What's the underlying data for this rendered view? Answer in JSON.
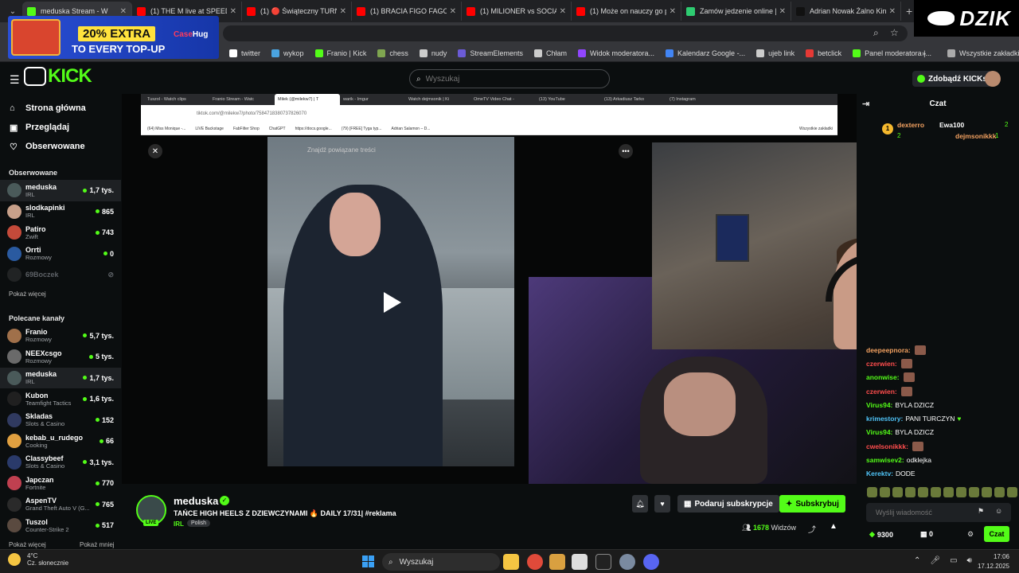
{
  "browser": {
    "tabs": [
      {
        "label": "meduska Stream - W",
        "color": "#53fc18",
        "active": true
      },
      {
        "label": "(1) THE M live at SPEEDL",
        "color": "#ff0000"
      },
      {
        "label": "(1) 🔴 Świąteczny TURNI",
        "color": "#ff0000"
      },
      {
        "label": "(1) BRACIA FIGO FAGOT",
        "color": "#ff0000"
      },
      {
        "label": "(1) MILIONER vs SOCIALI",
        "color": "#ff0000"
      },
      {
        "label": "(1) Może on nauczy go pr",
        "color": "#ff0000"
      },
      {
        "label": "Zamów jedzenie online |",
        "color": "#2ecc71"
      },
      {
        "label": "Adrian Nowak Żalno Kin",
        "color": "#111111"
      }
    ],
    "bookmarks": [
      {
        "label": "twitter",
        "color": "#ffffff"
      },
      {
        "label": "wykop",
        "color": "#4aa3df"
      },
      {
        "label": "Franio | Kick",
        "color": "#53fc18"
      },
      {
        "label": "chess",
        "color": "#7fa650"
      },
      {
        "label": "nudy",
        "color": "#cccccc"
      },
      {
        "label": "StreamElements",
        "color": "#6b5bd6"
      },
      {
        "label": "Chłam",
        "color": "#cccccc"
      },
      {
        "label": "Widok moderatora...",
        "color": "#9146ff"
      },
      {
        "label": "Kalendarz Google -...",
        "color": "#4285f4"
      },
      {
        "label": "ujeb link",
        "color": "#cccccc"
      },
      {
        "label": "betclick",
        "color": "#e53935"
      },
      {
        "label": "Panel moderatora |...",
        "color": "#53fc18"
      }
    ],
    "all_bookmarks": "Wszystkie zakładki"
  },
  "promo": {
    "pill": "20% EXTRA",
    "sub": "TO EVERY TOP-UP",
    "brand_a": "Case",
    "brand_b": "Hug"
  },
  "overlay_brand": "DZIK",
  "header": {
    "logo": "KICK",
    "search_placeholder": "Wyszukaj",
    "kicks_label": "Zdobądź KICKs"
  },
  "sidebar": {
    "nav": [
      {
        "label": "Strona główna",
        "icon": "home-icon",
        "glyph": "⌂"
      },
      {
        "label": "Przeglądaj",
        "icon": "browse-icon",
        "glyph": "▣"
      },
      {
        "label": "Obserwowane",
        "icon": "heart-icon",
        "glyph": "♡"
      }
    ],
    "followed_title": "Obserwowane",
    "followed": [
      {
        "name": "meduska",
        "category": "IRL",
        "viewers": "1,7 tys.",
        "color": "#4a5a5a",
        "selected": true
      },
      {
        "name": "slodkapinki",
        "category": "IRL",
        "viewers": "865",
        "color": "#c7a08a"
      },
      {
        "name": "Patiro",
        "category": "Zwift",
        "viewers": "743",
        "color": "#c44a3a"
      },
      {
        "name": "Orrti",
        "category": "Rozmowy",
        "viewers": "0",
        "color": "#2a5aa0"
      },
      {
        "name": "69Boczek",
        "category": "",
        "viewers": "",
        "color": "#444444",
        "offline": true
      }
    ],
    "show_more": "Pokaż więcej",
    "recommended_title": "Polecane kanały",
    "recommended": [
      {
        "name": "Franio",
        "category": "Rozmowy",
        "viewers": "5,7 tys.",
        "color": "#a0704a"
      },
      {
        "name": "NEEXcsgo",
        "category": "Rozmowy",
        "viewers": "5 tys.",
        "color": "#6a6a6a"
      },
      {
        "name": "meduska",
        "category": "IRL",
        "viewers": "1,7 tys.",
        "color": "#4a5a5a",
        "selected": true
      },
      {
        "name": "Kubon",
        "category": "Teamfight Tactics",
        "viewers": "1,6 tys.",
        "color": "#202020"
      },
      {
        "name": "Skladas",
        "category": "Slots & Casino",
        "viewers": "152",
        "color": "#303a60"
      },
      {
        "name": "kebab_u_rudego",
        "category": "Cooking",
        "viewers": "66",
        "color": "#e0a040"
      },
      {
        "name": "Classybeef",
        "category": "Slots & Casino",
        "viewers": "3,1 tys.",
        "color": "#2a3a6a"
      },
      {
        "name": "Japczan",
        "category": "Fortnite",
        "viewers": "770",
        "color": "#c04050"
      },
      {
        "name": "AspenTV",
        "category": "Grand Theft Auto V (G...",
        "viewers": "765",
        "color": "#2a2a2a"
      },
      {
        "name": "Tuszol",
        "category": "Counter-Strike 2",
        "viewers": "517",
        "color": "#5a4a40"
      }
    ],
    "show_more2": "Pokaż więcej",
    "show_less": "Pokaż mniej"
  },
  "inner_browser": {
    "tabs": [
      "Tuszol - Watch clips",
      "Franio Stream - Watc",
      "Milek (@milekw7) | T",
      "warik - Imgur",
      "Watch dejmsonik | Ki",
      "OmeTV Video Chat -",
      "(13) YouTube",
      "(13) Arkadiusz Tarko",
      "(7) Instagram"
    ],
    "url": "tiktok.com/@milekw7/photo/7584718380737826070",
    "bookmarks": [
      "(64) Miss Monique -...",
      "LIVE Backstage",
      "FabFilter Shop",
      "ChatGPT",
      "https://docs.google...",
      "(79) [FREE] Tyga typ...",
      "Adrian Salamon – D..."
    ],
    "all_bookmarks": "Wszystkie zakładki",
    "photo_search": "Znajdź powiązane treści"
  },
  "stream": {
    "streamer": "meduska",
    "title": "TAŃCE HIGH HEELS Z DZIEWCZYNAMI 🔥 DAILY 17/31| #reklama",
    "category": "IRL",
    "tag": "Polish",
    "live_badge": "LIVE",
    "gift_label": "Podaruj subskrypcje",
    "subscribe_label": "Subskrybuj",
    "viewers_count": "1678",
    "viewers_word": "Widzów"
  },
  "chat": {
    "title": "Czat",
    "leaderboard": {
      "first": "dexterro",
      "first_count": "2",
      "second": "Ewa100",
      "second_count": "2",
      "third": "dejmsonikkk",
      "third_count": "1"
    },
    "messages": [
      {
        "user": "deepeepnora:",
        "color": "#f4a261",
        "text": "",
        "emote": true
      },
      {
        "user": "czerwien:",
        "color": "#ff4d4d",
        "text": "",
        "emote": true
      },
      {
        "user": "anonwise:",
        "color": "#53fc18",
        "text": "",
        "emote": true
      },
      {
        "user": "czerwien:",
        "color": "#ff4d4d",
        "text": "",
        "emote": true
      },
      {
        "user": "Virus94:",
        "color": "#53fc18",
        "text": "BYLA DZICZ",
        "emote": false
      },
      {
        "user": "krimestory:",
        "color": "#4fc3f7",
        "text": "PANI TURCZYN",
        "emote": false,
        "heart": true
      },
      {
        "user": "Virus94:",
        "color": "#53fc18",
        "text": "BYLA DZICZ",
        "emote": false
      },
      {
        "user": "cwelsonikkk:",
        "color": "#ff4d4d",
        "text": "",
        "emote": true
      },
      {
        "user": "samwisev2:",
        "color": "#53fc18",
        "text": "odklejka",
        "emote": false
      },
      {
        "user": "Kerektv:",
        "color": "#4fc3f7",
        "text": "DODE",
        "emote": false
      }
    ],
    "input_placeholder": "Wyślij wiadomość",
    "points": "9300",
    "gifts": "0",
    "send_label": "Czat"
  },
  "taskbar": {
    "temp": "4°C",
    "weather": "Cz. słonecznie",
    "search": "Wyszukaj",
    "time": "17:06",
    "date": "17.12.2025"
  }
}
